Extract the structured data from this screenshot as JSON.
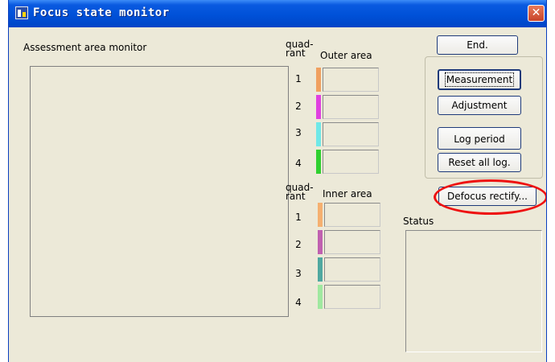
{
  "window": {
    "title": "Focus state monitor",
    "close_symbol": "✕"
  },
  "monitor": {
    "label": "Assessment area monitor"
  },
  "outer": {
    "quadrant_label": "quad-\nrant",
    "header": "Outer area",
    "rows": [
      {
        "num": "1",
        "color": "#f0a060"
      },
      {
        "num": "2",
        "color": "#e040e0"
      },
      {
        "num": "3",
        "color": "#70e8e8"
      },
      {
        "num": "4",
        "color": "#30d030"
      }
    ]
  },
  "inner": {
    "quadrant_label": "quad-\nrant",
    "header": "Inner area",
    "rows": [
      {
        "num": "1",
        "color": "#f5b070"
      },
      {
        "num": "2",
        "color": "#c060b0"
      },
      {
        "num": "3",
        "color": "#50a8a0"
      },
      {
        "num": "4",
        "color": "#a0e8a0"
      }
    ]
  },
  "buttons": {
    "end": "End.",
    "measurement": "Measurement",
    "adjustment": "Adjustment",
    "log_period": "Log period",
    "reset_all_log": "Reset all log.",
    "defocus_rectify": "Defocus rectify..."
  },
  "status": {
    "label": "Status"
  }
}
